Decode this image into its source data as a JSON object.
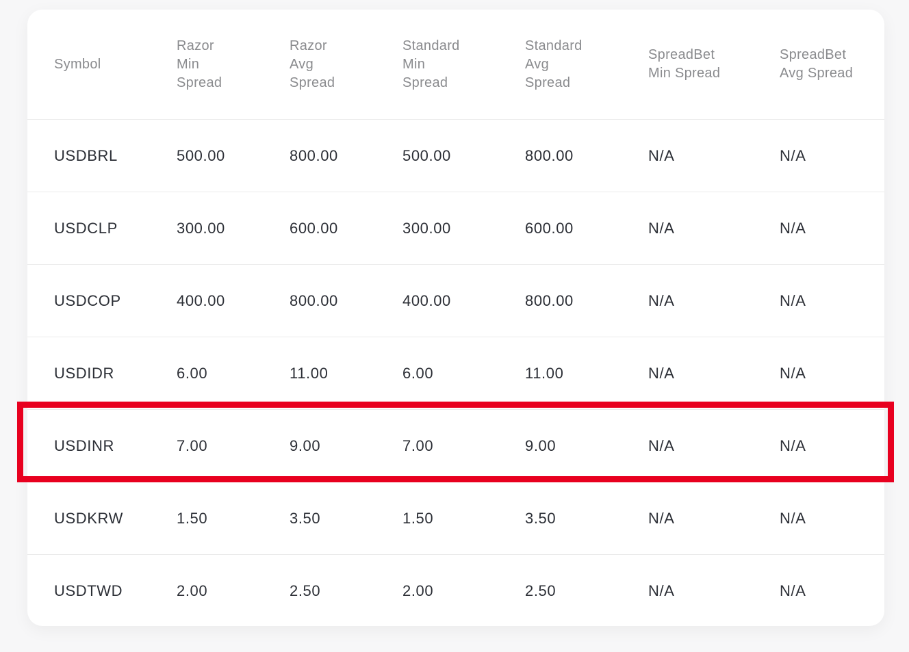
{
  "table": {
    "headers": [
      "Symbol",
      "Razor\nMin\nSpread",
      "Razor\nAvg\nSpread",
      "Standard\nMin\nSpread",
      "Standard\nAvg\nSpread",
      "SpreadBet\nMin Spread",
      "SpreadBet\nAvg Spread"
    ],
    "rows": [
      [
        "USDBRL",
        "500.00",
        "800.00",
        "500.00",
        "800.00",
        "N/A",
        "N/A"
      ],
      [
        "USDCLP",
        "300.00",
        "600.00",
        "300.00",
        "600.00",
        "N/A",
        "N/A"
      ],
      [
        "USDCOP",
        "400.00",
        "800.00",
        "400.00",
        "800.00",
        "N/A",
        "N/A"
      ],
      [
        "USDIDR",
        "6.00",
        "11.00",
        "6.00",
        "11.00",
        "N/A",
        "N/A"
      ],
      [
        "USDINR",
        "7.00",
        "9.00",
        "7.00",
        "9.00",
        "N/A",
        "N/A"
      ],
      [
        "USDKRW",
        "1.50",
        "3.50",
        "1.50",
        "3.50",
        "N/A",
        "N/A"
      ],
      [
        "USDTWD",
        "2.00",
        "2.50",
        "2.00",
        "2.50",
        "N/A",
        "N/A"
      ]
    ],
    "highlighted_row": "USDINR",
    "highlight_color": "#e8001f"
  }
}
